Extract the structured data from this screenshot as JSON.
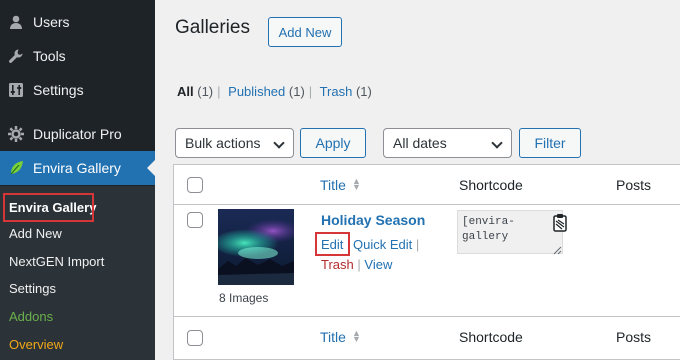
{
  "sidebar": {
    "menu": [
      {
        "label": "Users",
        "icon": "user-icon"
      },
      {
        "label": "Tools",
        "icon": "wrench-icon"
      },
      {
        "label": "Settings",
        "icon": "settings-sliders-icon"
      },
      {
        "label": "Duplicator Pro",
        "icon": "duplicator-icon"
      },
      {
        "label": "Envira Gallery",
        "icon": "leaf-icon"
      }
    ],
    "submenu": [
      {
        "label": "Envira Gallery"
      },
      {
        "label": "Add New"
      },
      {
        "label": "NextGEN Import"
      },
      {
        "label": "Settings"
      },
      {
        "label": "Addons"
      },
      {
        "label": "Overview"
      }
    ]
  },
  "header": {
    "title": "Galleries",
    "add_new": "Add New"
  },
  "filters": {
    "all": "All",
    "all_count": "(1)",
    "published": "Published",
    "published_count": "(1)",
    "trash": "Trash",
    "trash_count": "(1)",
    "sep": "|"
  },
  "controls": {
    "bulk_actions": "Bulk actions",
    "apply": "Apply",
    "dates": "All dates",
    "filter": "Filter"
  },
  "table": {
    "columns": {
      "title": "Title",
      "shortcode": "Shortcode",
      "posts": "Posts"
    },
    "rows": [
      {
        "title": "Holiday Season",
        "caption": "8 Images",
        "shortcode_line1": "[envira-",
        "shortcode_line2": "gallery",
        "actions": {
          "edit": "Edit",
          "quick_edit": "Quick Edit",
          "trash": "Trash",
          "view": "View",
          "sep": "|"
        }
      }
    ]
  },
  "colors": {
    "sidebar_bg": "#1d2327",
    "accent": "#2271b1",
    "highlight": "#d63638",
    "addons": "#6ab04c",
    "overview": "#f0a818"
  }
}
